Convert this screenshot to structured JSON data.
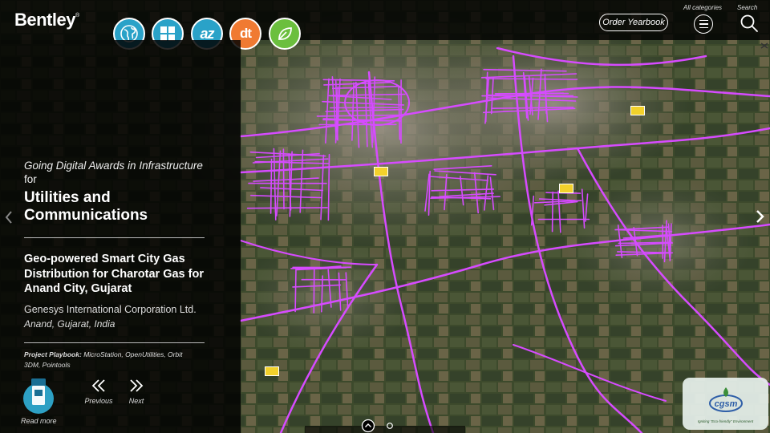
{
  "brand": {
    "logo_text": "Bentley",
    "logo_mark": "®"
  },
  "header": {
    "icon_buttons": [
      {
        "icon": "globe-icon",
        "color": "#2aa2c8"
      },
      {
        "icon": "grid-icon",
        "color": "#2aa2c8"
      },
      {
        "icon": "az-index-icon",
        "color": "#2aa2c8",
        "text": "az"
      },
      {
        "icon": "dt-icon",
        "color": "#f07a32",
        "text": "dt"
      },
      {
        "icon": "leaf-icon",
        "color": "#6bbf3e"
      }
    ],
    "order_label": "Order Yearbook",
    "categories_label": "All categories",
    "search_label": "Search"
  },
  "panel": {
    "intro_line": "Going Digital Awards in Infrastructure",
    "intro_for": "for",
    "category": "Utilities and Communications",
    "project_title": "Geo-powered Smart City Gas Distribution for Charotar Gas for Anand City, Gujarat",
    "company": "Genesys International Corporation Ltd.",
    "location": "Anand, Gujarat, India",
    "playbook_label": "Project Playbook:",
    "playbook_text": "MicroStation, OpenUtilities, Orbit 3DM, Pointools",
    "read_more": "Read more",
    "previous": "Previous",
    "next": "Next"
  },
  "map": {
    "pipeline_color": "#d64bff",
    "marker_color": "#f3d12b",
    "sponsor_logo_text": "cgsm",
    "sponsor_tagline": "Igniting \"Eco-friendly\" Environment"
  },
  "colors": {
    "panel": "#000000",
    "accent": "#2aa2c8"
  }
}
